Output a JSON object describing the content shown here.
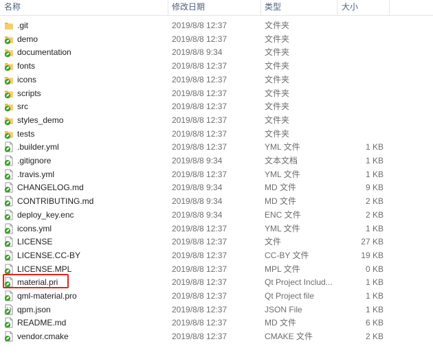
{
  "columns": {
    "name": "名称",
    "date": "修改日期",
    "type": "类型",
    "size": "大小"
  },
  "colors": {
    "folder": "#e8b84a",
    "leaf_green": "#3f9d2f",
    "highlight_border": "#e8201c"
  },
  "files": [
    {
      "name": ".git",
      "date": "2019/8/8 12:37",
      "type": "文件夹",
      "size": "",
      "icon": "folder-icon"
    },
    {
      "name": "demo",
      "date": "2019/8/8 12:37",
      "type": "文件夹",
      "size": "",
      "icon": "folder-sync-icon"
    },
    {
      "name": "documentation",
      "date": "2019/8/8 9:34",
      "type": "文件夹",
      "size": "",
      "icon": "folder-sync-icon"
    },
    {
      "name": "fonts",
      "date": "2019/8/8 12:37",
      "type": "文件夹",
      "size": "",
      "icon": "folder-sync-icon"
    },
    {
      "name": "icons",
      "date": "2019/8/8 12:37",
      "type": "文件夹",
      "size": "",
      "icon": "folder-sync-icon"
    },
    {
      "name": "scripts",
      "date": "2019/8/8 12:37",
      "type": "文件夹",
      "size": "",
      "icon": "folder-sync-icon"
    },
    {
      "name": "src",
      "date": "2019/8/8 12:37",
      "type": "文件夹",
      "size": "",
      "icon": "folder-sync-icon"
    },
    {
      "name": "styles_demo",
      "date": "2019/8/8 12:37",
      "type": "文件夹",
      "size": "",
      "icon": "folder-sync-icon"
    },
    {
      "name": "tests",
      "date": "2019/8/8 12:37",
      "type": "文件夹",
      "size": "",
      "icon": "folder-sync-icon"
    },
    {
      "name": ".builder.yml",
      "date": "2019/8/8 12:37",
      "type": "YML 文件",
      "size": "1 KB",
      "icon": "file-sync-icon"
    },
    {
      "name": ".gitignore",
      "date": "2019/8/8 9:34",
      "type": "文本文档",
      "size": "1 KB",
      "icon": "file-sync-icon"
    },
    {
      "name": ".travis.yml",
      "date": "2019/8/8 12:37",
      "type": "YML 文件",
      "size": "1 KB",
      "icon": "file-sync-icon"
    },
    {
      "name": "CHANGELOG.md",
      "date": "2019/8/8 9:34",
      "type": "MD 文件",
      "size": "9 KB",
      "icon": "file-sync-icon"
    },
    {
      "name": "CONTRIBUTING.md",
      "date": "2019/8/8 9:34",
      "type": "MD 文件",
      "size": "2 KB",
      "icon": "file-sync-icon"
    },
    {
      "name": "deploy_key.enc",
      "date": "2019/8/8 9:34",
      "type": "ENC 文件",
      "size": "2 KB",
      "icon": "file-sync-icon"
    },
    {
      "name": "icons.yml",
      "date": "2019/8/8 12:37",
      "type": "YML 文件",
      "size": "1 KB",
      "icon": "file-sync-icon"
    },
    {
      "name": "LICENSE",
      "date": "2019/8/8 12:37",
      "type": "文件",
      "size": "27 KB",
      "icon": "file-sync-icon"
    },
    {
      "name": "LICENSE.CC-BY",
      "date": "2019/8/8 12:37",
      "type": "CC-BY 文件",
      "size": "19 KB",
      "icon": "file-sync-icon"
    },
    {
      "name": "LICENSE.MPL",
      "date": "2019/8/8 12:37",
      "type": "MPL 文件",
      "size": "0 KB",
      "icon": "file-sync-icon"
    },
    {
      "name": "material.pri",
      "date": "2019/8/8 12:37",
      "type": "Qt Project Includ...",
      "size": "1 KB",
      "icon": "file-sync-icon"
    },
    {
      "name": "qml-material.pro",
      "date": "2019/8/8 12:37",
      "type": "Qt Project file",
      "size": "1 KB",
      "icon": "file-sync-icon"
    },
    {
      "name": "qpm.json",
      "date": "2019/8/8 12:37",
      "type": "JSON File",
      "size": "1 KB",
      "icon": "json-file-sync-icon"
    },
    {
      "name": "README.md",
      "date": "2019/8/8 12:37",
      "type": "MD 文件",
      "size": "6 KB",
      "icon": "file-sync-icon"
    },
    {
      "name": "vendor.cmake",
      "date": "2019/8/8 12:37",
      "type": "CMAKE 文件",
      "size": "2 KB",
      "icon": "file-sync-icon"
    }
  ]
}
